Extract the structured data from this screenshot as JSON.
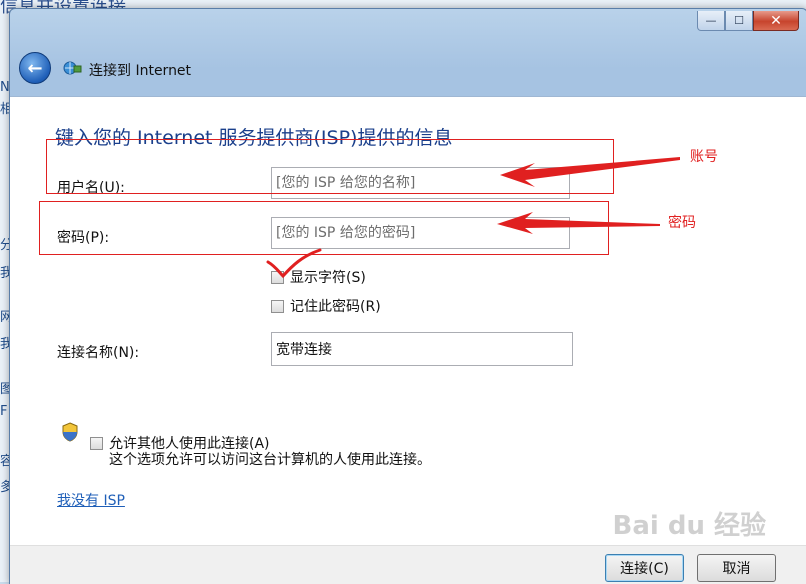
{
  "background": {
    "title_fragment": "信息并设置连接",
    "edge_glyphs": [
      "N",
      "相",
      "分",
      "我",
      "网",
      "我",
      "图",
      "F",
      "容",
      "多"
    ]
  },
  "window": {
    "title": "连接到 Internet",
    "caption": {
      "minimize": "—",
      "maximize": "☐",
      "close": "✕"
    }
  },
  "form": {
    "heading": "键入您的 Internet 服务提供商(ISP)提供的信息",
    "username": {
      "label": "用户名(U):",
      "placeholder": "[您的 ISP 给您的名称]",
      "value": ""
    },
    "password": {
      "label": "密码(P):",
      "placeholder": "[您的 ISP 给您的密码]",
      "value": ""
    },
    "show_chars": {
      "label": "显示字符(S)",
      "checked": false
    },
    "remember_password": {
      "label": "记住此密码(R)",
      "checked": false
    },
    "connection_name": {
      "label": "连接名称(N):",
      "value": "宽带连接"
    },
    "allow_others": {
      "label": "允许其他人使用此连接(A)",
      "checked": false,
      "description": "这个选项允许可以访问这台计算机的人使用此连接。"
    },
    "no_isp_link": "我没有 ISP"
  },
  "footer": {
    "connect": "连接(C)",
    "cancel": "取消"
  },
  "annotations": {
    "account": "账号",
    "password": "密码",
    "color": "#e02020"
  },
  "watermark": "Bai du 经验"
}
